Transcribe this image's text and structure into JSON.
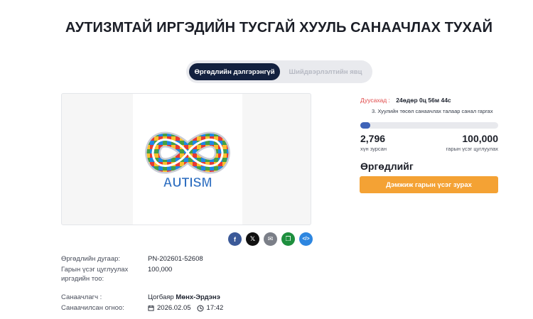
{
  "page": {
    "title": "АУТИЗМТАЙ ИРГЭДИЙН ТУСГАЙ ХУУЛЬ САНААЧЛАХ ТУХАЙ"
  },
  "tabs": [
    {
      "label": "Өргөдлийн дэлгэрэнгүй",
      "active": true
    },
    {
      "label": "Шийдвэрлэлтийн явц",
      "active": false
    }
  ],
  "image": {
    "logo_text": "AUTISM",
    "alt": "autism infinity puzzle logo"
  },
  "share": [
    {
      "icon": "facebook-icon",
      "glyph": "f",
      "color": "#3b5998"
    },
    {
      "icon": "x-icon",
      "glyph": "𝕏",
      "color": "#111111"
    },
    {
      "icon": "mail-icon",
      "glyph": "✉",
      "color": "#7b7f88"
    },
    {
      "icon": "copy-icon",
      "glyph": "❐",
      "color": "#1e8f3e"
    },
    {
      "icon": "embed-icon",
      "glyph": "</>",
      "color": "#2d86e0"
    }
  ],
  "details": {
    "petition_no_label": "Өргөдлийн дугаар:",
    "petition_no_value": "PN-202601-52608",
    "target_label_line1": "Гарын үсэг цуглуулах",
    "target_label_line2": "иргэдийн тоо:",
    "target_value": "100,000",
    "initiator_label": "Санаачлагч :",
    "initiator_first": "Цогбаяр",
    "initiator_last": "Мөнх-Эрдэнэ",
    "date_label": "Санаачилсан огноо:",
    "date_value": "2026.02.05",
    "time_value": "17:42"
  },
  "sidebar": {
    "deadline_label": "Дуусахад :",
    "deadline_value": "24өдөр 0ц 56м 44с",
    "step_text": "3. Хуулийн төсөл санаачлах талаар санал гаргах",
    "progress_fraction": 0.028,
    "signed_count": "2,796",
    "signed_label": "хүн зурсан",
    "goal_count": "100,000",
    "goal_label": "гарын үсэг цуглуулах",
    "sign_heading": "Өргөдлийг",
    "sign_button": "Дэмжиж гарын үсэг зурах"
  },
  "colors": {
    "navy": "#13213f",
    "accent_orange": "#f4a234",
    "deadline_red": "#e04848",
    "progress_blue": "#3f63b8"
  }
}
